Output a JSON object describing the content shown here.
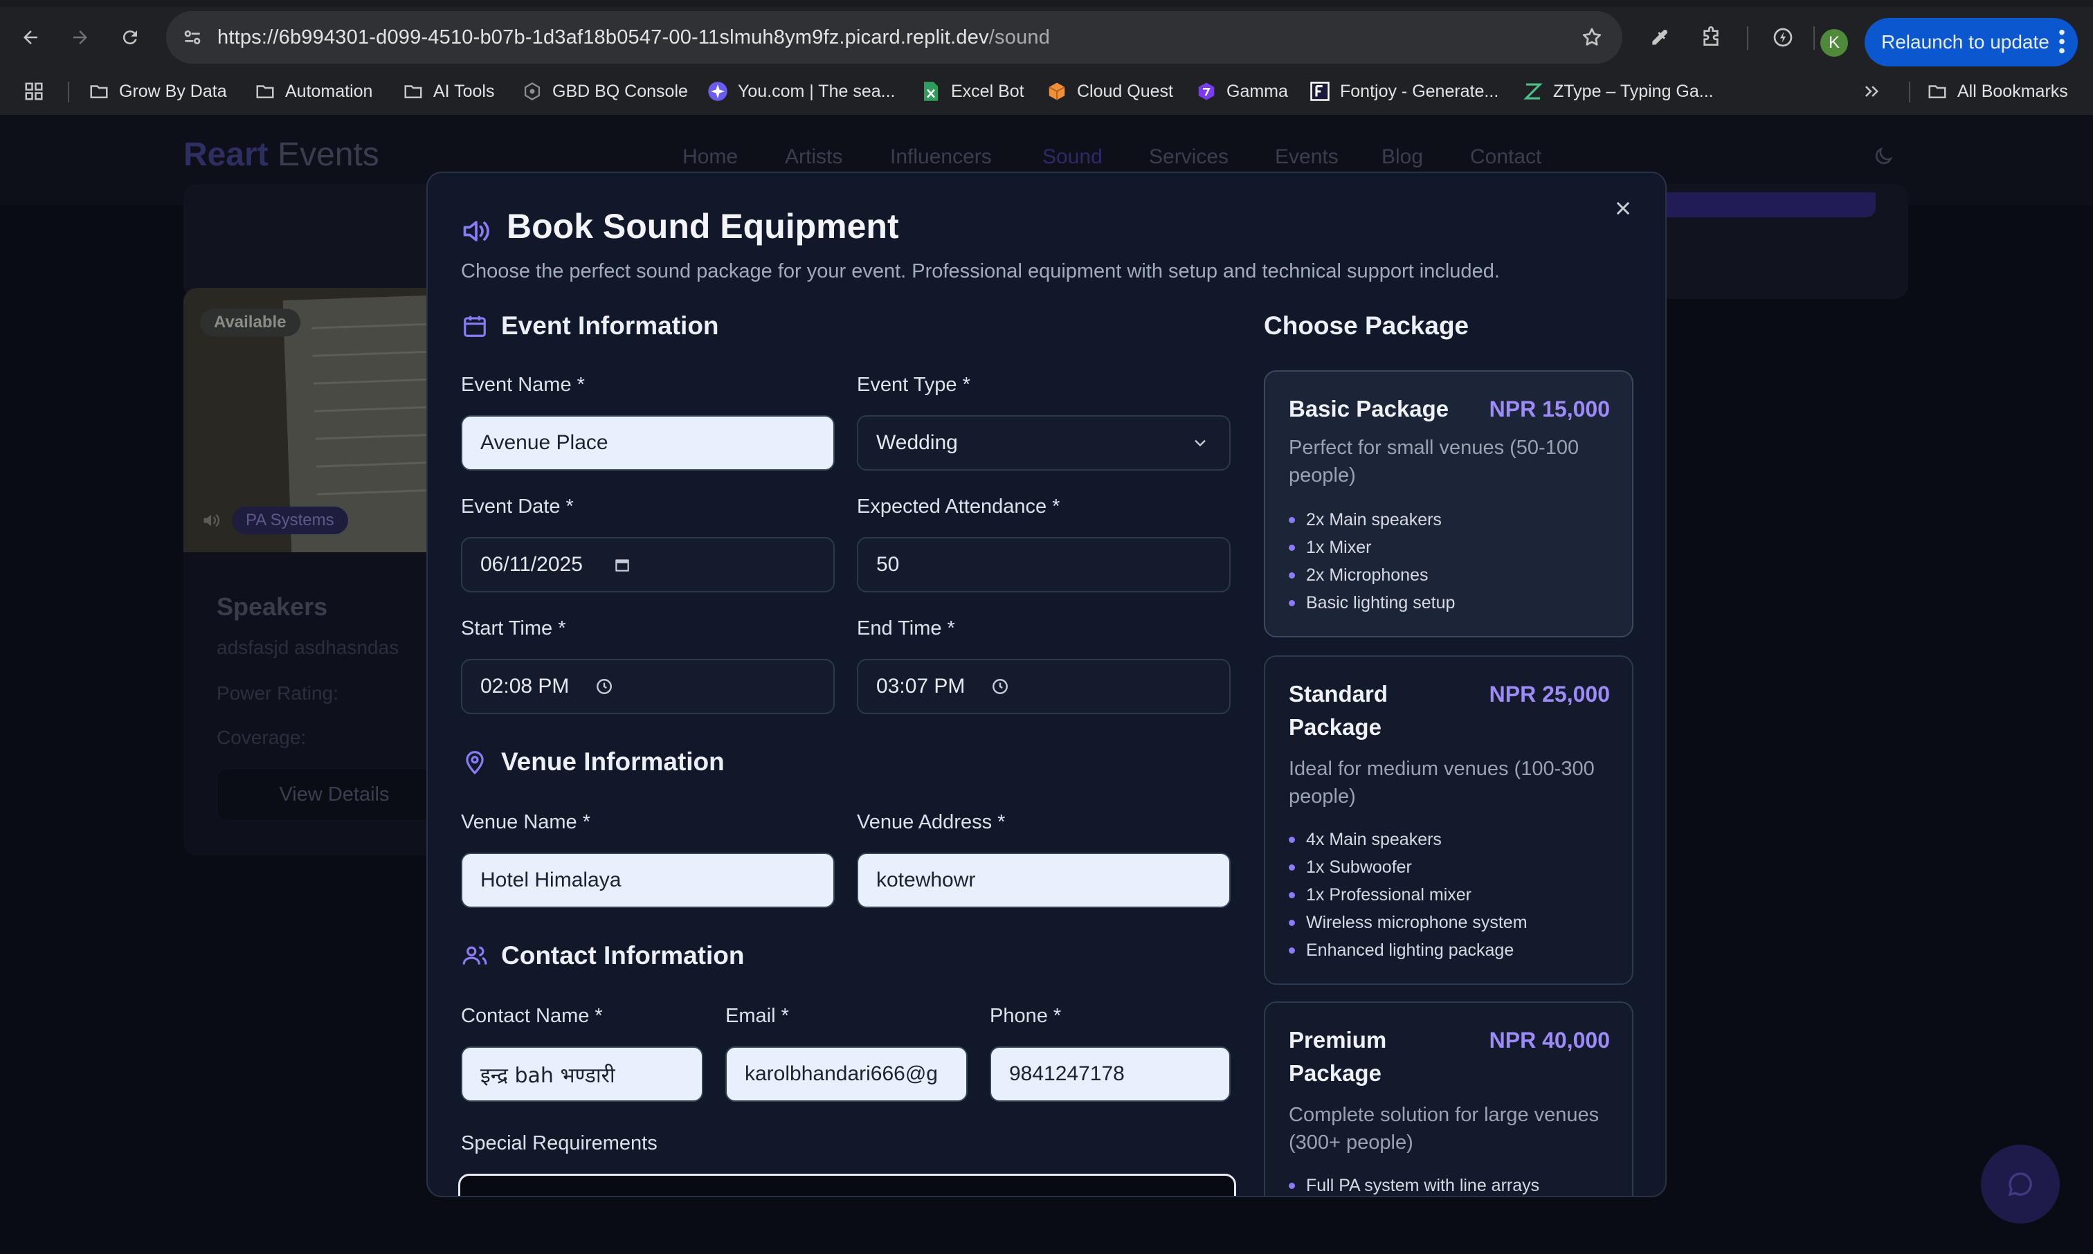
{
  "browser": {
    "url": {
      "main": "https://6b994301-d099-4510-b07b-1d3af18b0547-00-11slmuh8ym9fz.picard.replit.dev",
      "path": "/sound"
    },
    "avatar_letter": "K",
    "relaunch_label": "Relaunch to update",
    "bookmarks": [
      {
        "label": "Grow By Data",
        "icon": "folder-icon"
      },
      {
        "label": "Automation",
        "icon": "folder-icon"
      },
      {
        "label": "AI Tools",
        "icon": "folder-icon"
      },
      {
        "label": "GBD BQ Console",
        "icon": "bigquery-icon"
      },
      {
        "label": "You.com | The sea...",
        "icon": "you-com-icon"
      },
      {
        "label": "Excel Bot",
        "icon": "excel-bot-icon"
      },
      {
        "label": "Cloud Quest",
        "icon": "cloud-quest-icon"
      },
      {
        "label": "Gamma",
        "icon": "gamma-icon"
      },
      {
        "label": "Fontjoy - Generate...",
        "icon": "fontjoy-icon"
      },
      {
        "label": "ZType – Typing Ga...",
        "icon": "ztype-icon"
      }
    ],
    "all_bookmarks": "All Bookmarks"
  },
  "site": {
    "logo_primary": "Reart",
    "logo_secondary": "Events",
    "nav": [
      "Home",
      "Artists",
      "Influencers",
      "Sound",
      "Services",
      "Events",
      "Blog",
      "Contact"
    ],
    "active_nav": "Sound"
  },
  "background_card": {
    "badge": "Available",
    "category": "PA Systems",
    "name": "Speakers",
    "description": "adsfasjd asdhasndas",
    "power_label": "Power Rating:",
    "coverage_label": "Coverage:",
    "button": "View Details"
  },
  "modal": {
    "title": "Book Sound Equipment",
    "description": "Choose the perfect sound package for your event. Professional equipment with setup and technical support included.",
    "event_section": "Event Information",
    "venue_section": "Venue Information",
    "contact_section": "Contact Information",
    "fields": {
      "event_name": {
        "label": "Event Name *",
        "value": "Avenue Place"
      },
      "event_type": {
        "label": "Event Type *",
        "value": "Wedding"
      },
      "event_date": {
        "label": "Event Date *",
        "value": "06/11/2025"
      },
      "attendance": {
        "label": "Expected Attendance *",
        "value": "50"
      },
      "start_time": {
        "label": "Start Time *",
        "value": "02:08 PM"
      },
      "end_time": {
        "label": "End Time *",
        "value": "03:07 PM"
      },
      "venue_name": {
        "label": "Venue Name *",
        "value": "Hotel Himalaya"
      },
      "venue_address": {
        "label": "Venue Address *",
        "value": "kotewhowr"
      },
      "contact_name": {
        "label": "Contact Name *",
        "value": "इन्द्र bah भण्डारी"
      },
      "email": {
        "label": "Email *",
        "value": "karolbhandari666@g"
      },
      "phone": {
        "label": "Phone *",
        "value": "9841247178"
      },
      "special": {
        "label": "Special Requirements"
      }
    },
    "packages_title": "Choose Package",
    "packages": [
      {
        "name": "Basic Package",
        "price": "NPR 15,000",
        "description": "Perfect for small venues (50-100 people)",
        "features": [
          "2x Main speakers",
          "1x Mixer",
          "2x Microphones",
          "Basic lighting setup"
        ]
      },
      {
        "name": "Standard Package",
        "price": "NPR 25,000",
        "description": "Ideal for medium venues (100-300 people)",
        "features": [
          "4x Main speakers",
          "1x Subwoofer",
          "1x Professional mixer",
          "Wireless microphone system",
          "Enhanced lighting package"
        ]
      },
      {
        "name": "Premium Package",
        "price": "NPR 40,000",
        "description": "Complete solution for large venues (300+ people)",
        "features": [
          "Full PA system with line arrays"
        ]
      }
    ]
  },
  "colors": {
    "accent": "#8b7cf6",
    "price": "#9d8cf8",
    "modal_bg": "#10182a",
    "relaunch": "#0b57d0"
  }
}
